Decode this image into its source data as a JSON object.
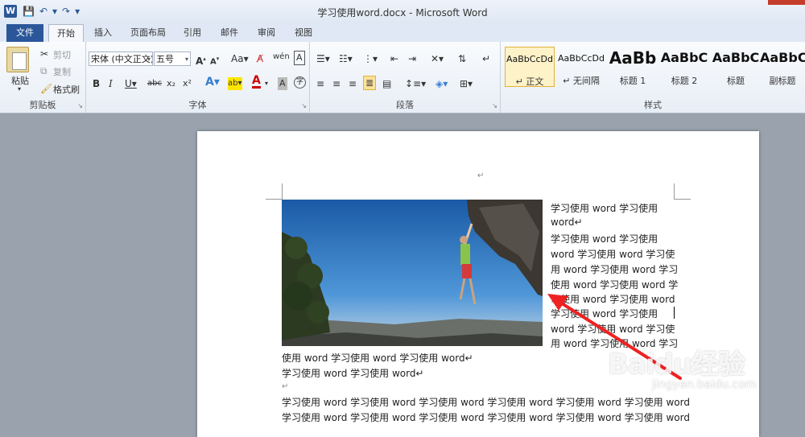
{
  "window": {
    "title": "学习使用word.docx - Microsoft Word"
  },
  "tabs": [
    {
      "label": "文件"
    },
    {
      "label": "开始"
    },
    {
      "label": "插入"
    },
    {
      "label": "页面布局"
    },
    {
      "label": "引用"
    },
    {
      "label": "邮件"
    },
    {
      "label": "审阅"
    },
    {
      "label": "视图"
    }
  ],
  "clipboard": {
    "paste": "粘贴",
    "cut": "剪切",
    "copy": "复制",
    "format_painter": "格式刷",
    "label": "剪贴板"
  },
  "font": {
    "name": "宋体 (中文正文)",
    "size": "五号",
    "label": "字体"
  },
  "paragraph": {
    "label": "段落"
  },
  "styles": {
    "label": "样式",
    "items": [
      {
        "preview": "AaBbCcDd",
        "name": "↵ 正文"
      },
      {
        "preview": "AaBbCcDd",
        "name": "↵ 无间隔"
      },
      {
        "preview": "AaBb",
        "name": "标题 1"
      },
      {
        "preview": "AaBbC",
        "name": "标题 2"
      },
      {
        "preview": "AaBbC",
        "name": "标题"
      },
      {
        "preview": "AaBbC",
        "name": "副标题"
      }
    ]
  },
  "document": {
    "para_mark": "↵",
    "right_lines": [
      "学习使用 word 学习使用",
      "word↵",
      "学习使用 word 学习使用",
      "word 学习使用 word 学习使",
      "用 word 学习使用 word 学习",
      "使用 word 学习使用 word 学",
      "习使用 word 学习使用 word",
      "学习使用 word 学习使用",
      "word 学习使用 word 学习使",
      "用 word 学习使用 word 学习"
    ],
    "full_lines": [
      "使用 word 学习使用 word 学习使用 word↵",
      "学习使用 word 学习使用 word↵",
      "↵",
      "学习使用 word 学习使用 word 学习使用 word 学习使用 word 学习使用 word 学习使用 word",
      "学习使用 word 学习使用 word 学习使用 word 学习使用 word 学习使用 word 学习使用 word"
    ]
  },
  "watermark": {
    "brand": "Baidu经验",
    "url": "jingyan.baidu.com"
  }
}
